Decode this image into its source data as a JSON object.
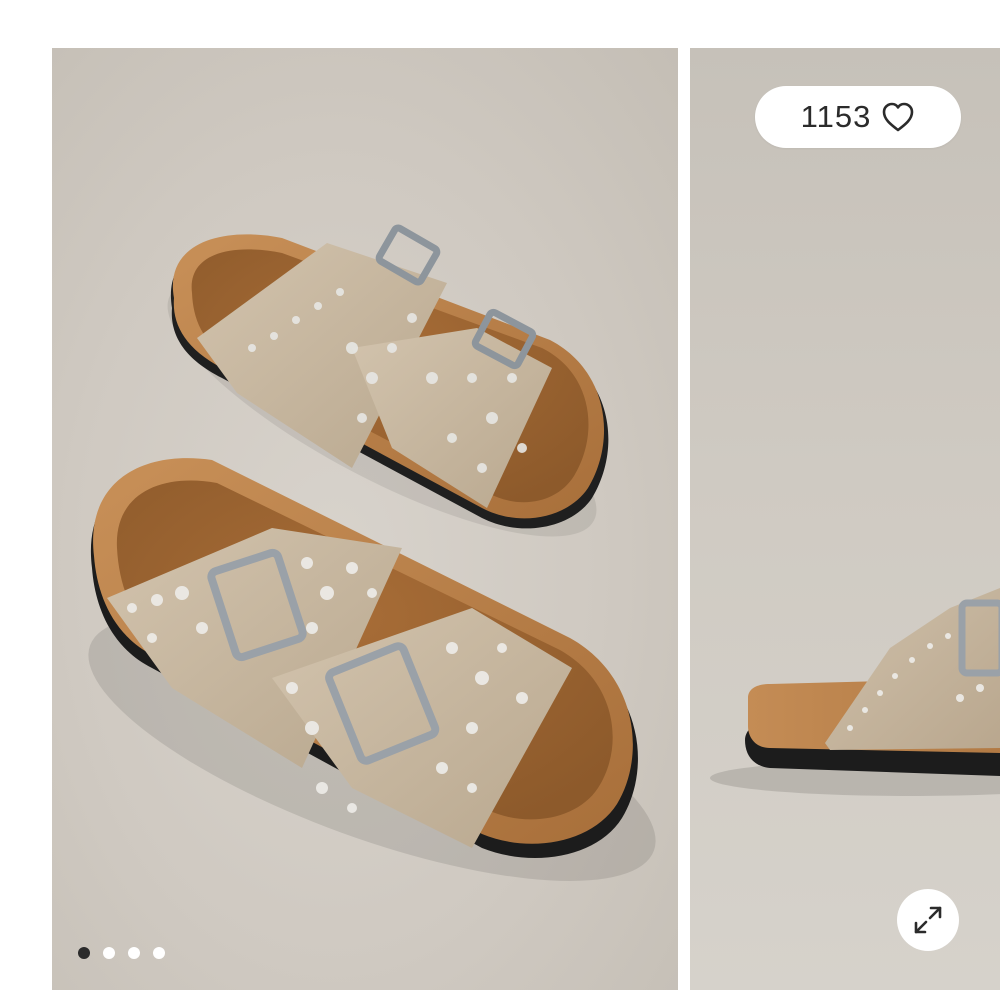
{
  "gallery": {
    "likes": {
      "count": "1153",
      "icon": "heart-icon"
    },
    "expand": {
      "icon": "expand-icon"
    },
    "pagination": {
      "total": 4,
      "active_index": 0
    }
  },
  "colors": {
    "background": "#ffffff",
    "suede": "#c8b8a2",
    "cork": "#b9824a",
    "sole": "#222222",
    "active_dot": "#2b2b2b"
  }
}
